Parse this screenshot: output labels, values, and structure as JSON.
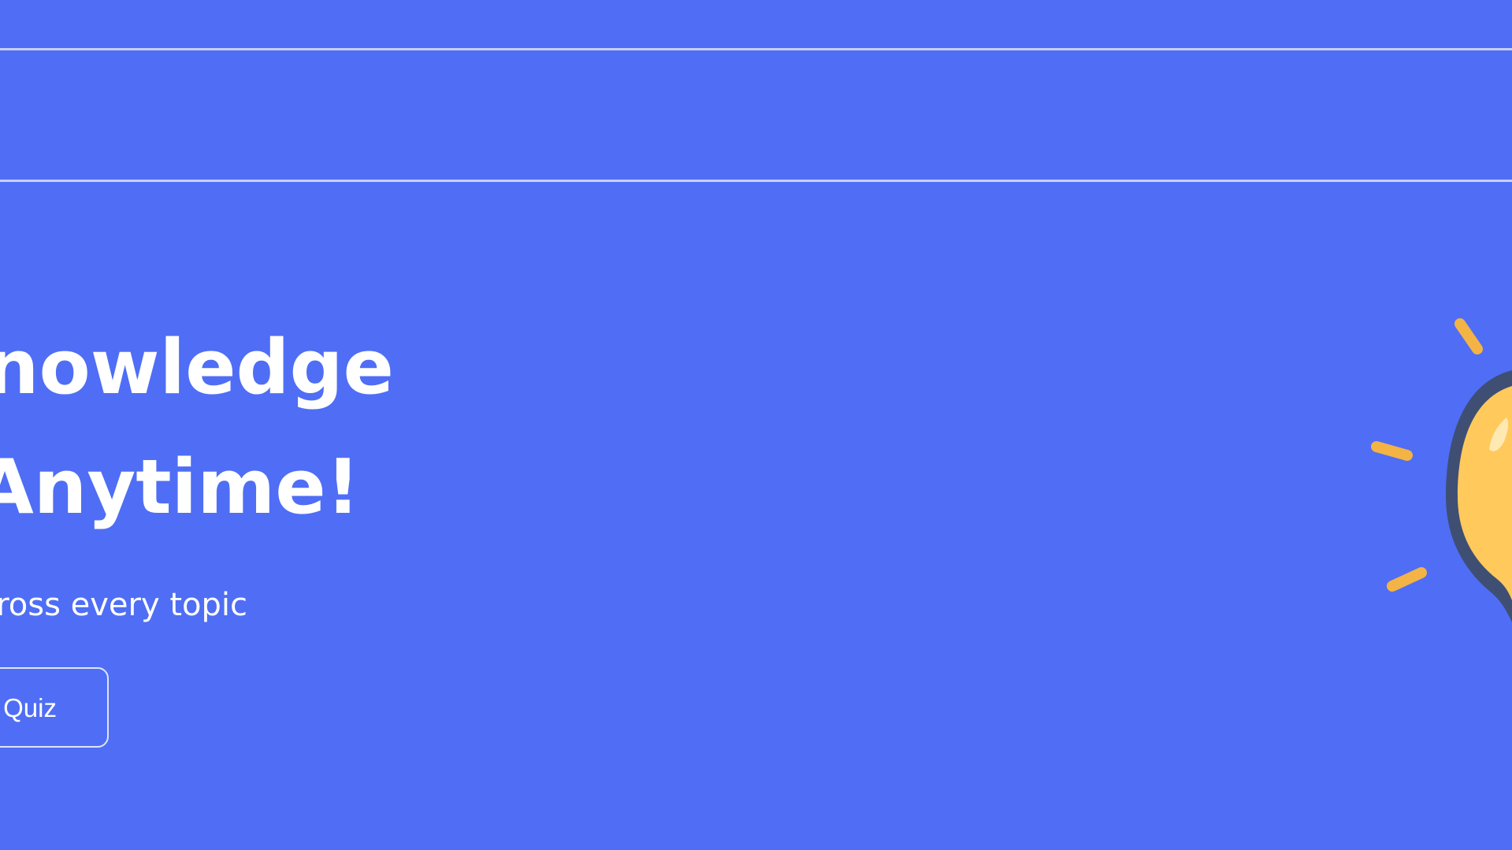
{
  "hero": {
    "headline_line1": "knowledge",
    "headline_line2": "Anytime!",
    "subtitle": "ross every topic",
    "cta_label": "Quiz"
  },
  "illustration": {
    "icon": "lightbulb-icon",
    "rays_color": "#f4b345",
    "bulb_color": "#ffc95c",
    "outline_color": "#3f4f73"
  },
  "colors": {
    "background": "#4f6ef5",
    "divider": "#c6d0fb",
    "text": "#ffffff"
  }
}
